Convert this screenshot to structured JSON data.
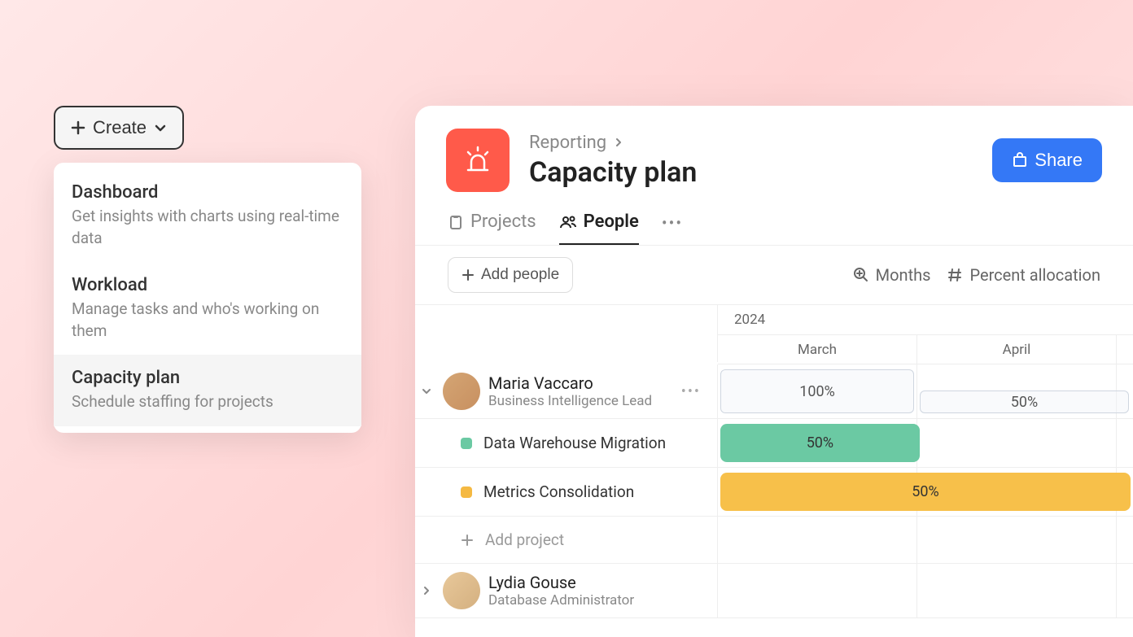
{
  "create_button": {
    "label": "Create"
  },
  "dropdown": {
    "items": [
      {
        "title": "Dashboard",
        "desc": "Get insights with charts using real-time data"
      },
      {
        "title": "Workload",
        "desc": "Manage tasks and who's working on them"
      },
      {
        "title": "Capacity plan",
        "desc": "Schedule staffing for projects"
      }
    ]
  },
  "breadcrumb": {
    "parent": "Reporting"
  },
  "page_title": "Capacity plan",
  "share_label": "Share",
  "tabs": {
    "projects": "Projects",
    "people": "People"
  },
  "toolbar": {
    "add_people": "Add people",
    "zoom": "Months",
    "mode": "Percent allocation"
  },
  "timeline": {
    "year": "2024",
    "months": [
      "March",
      "April"
    ]
  },
  "people": [
    {
      "name": "Maria Vaccaro",
      "role": "Business Intelligence Lead",
      "allocations": {
        "march": "100%",
        "april": "50%"
      },
      "projects": [
        {
          "name": "Data Warehouse Migration",
          "color": "green",
          "alloc": "50%"
        },
        {
          "name": "Metrics Consolidation",
          "color": "yellow",
          "alloc": "50%"
        }
      ],
      "add_project": "Add project"
    },
    {
      "name": "Lydia Gouse",
      "role": "Database Administrator"
    }
  ]
}
